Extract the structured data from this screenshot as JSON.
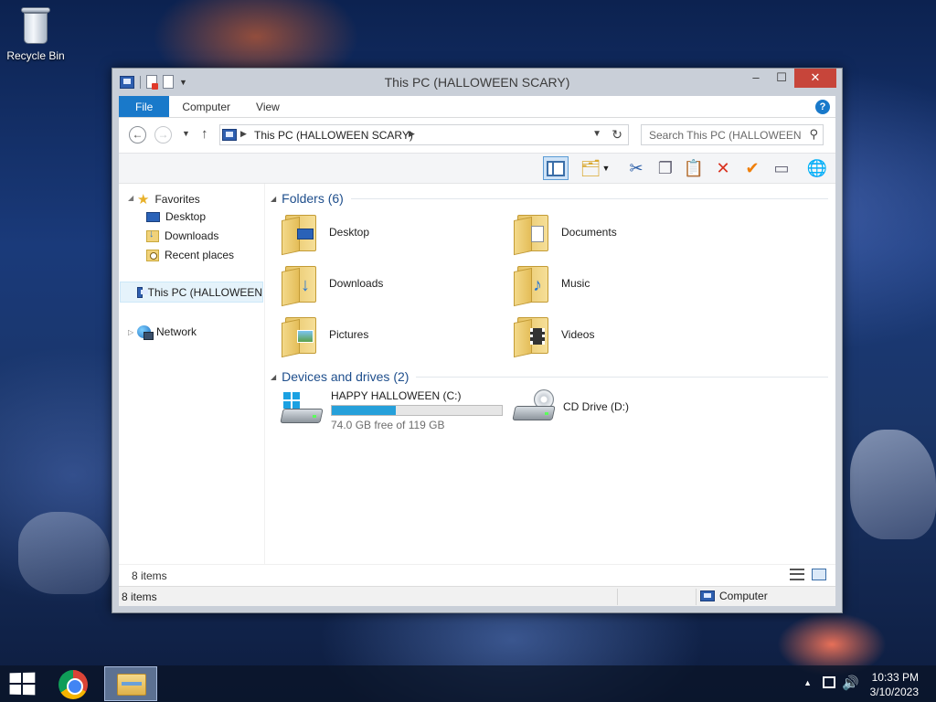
{
  "desktop": {
    "recycle_bin_label": "Recycle Bin"
  },
  "window": {
    "title": "This PC (HALLOWEEN SCARY)",
    "ribbon_tabs": [
      {
        "label": "File"
      },
      {
        "label": "Computer"
      },
      {
        "label": "View"
      }
    ],
    "help_label": "?",
    "address": {
      "path": "This PC (HALLOWEEN SCARY)"
    },
    "search": {
      "placeholder": "Search This PC (HALLOWEEN ..."
    },
    "navpane": {
      "favorites_label": "Favorites",
      "favorites": [
        {
          "label": "Desktop"
        },
        {
          "label": "Downloads"
        },
        {
          "label": "Recent places"
        }
      ],
      "this_pc_label": "This PC (HALLOWEEN",
      "network_label": "Network"
    },
    "folders": {
      "header": "Folders (6)",
      "items": [
        {
          "label": "Desktop"
        },
        {
          "label": "Documents"
        },
        {
          "label": "Downloads"
        },
        {
          "label": "Music"
        },
        {
          "label": "Pictures"
        },
        {
          "label": "Videos"
        }
      ]
    },
    "devices": {
      "header": "Devices and drives (2)",
      "drives": [
        {
          "name": "HAPPY HALLOWEEN (C:)",
          "free_text": "74.0 GB free of 119 GB",
          "used_fraction": 0.378
        },
        {
          "name": "CD Drive (D:)"
        }
      ]
    },
    "footer_count": "8 items",
    "status": {
      "count": "8 items",
      "location": "Computer"
    }
  },
  "taskbar": {
    "time": "10:33 PM",
    "date": "3/10/2023"
  },
  "colors": {
    "accent": "#1979ca",
    "close_button": "#c7453a",
    "drive_bar": "#26a0da"
  }
}
